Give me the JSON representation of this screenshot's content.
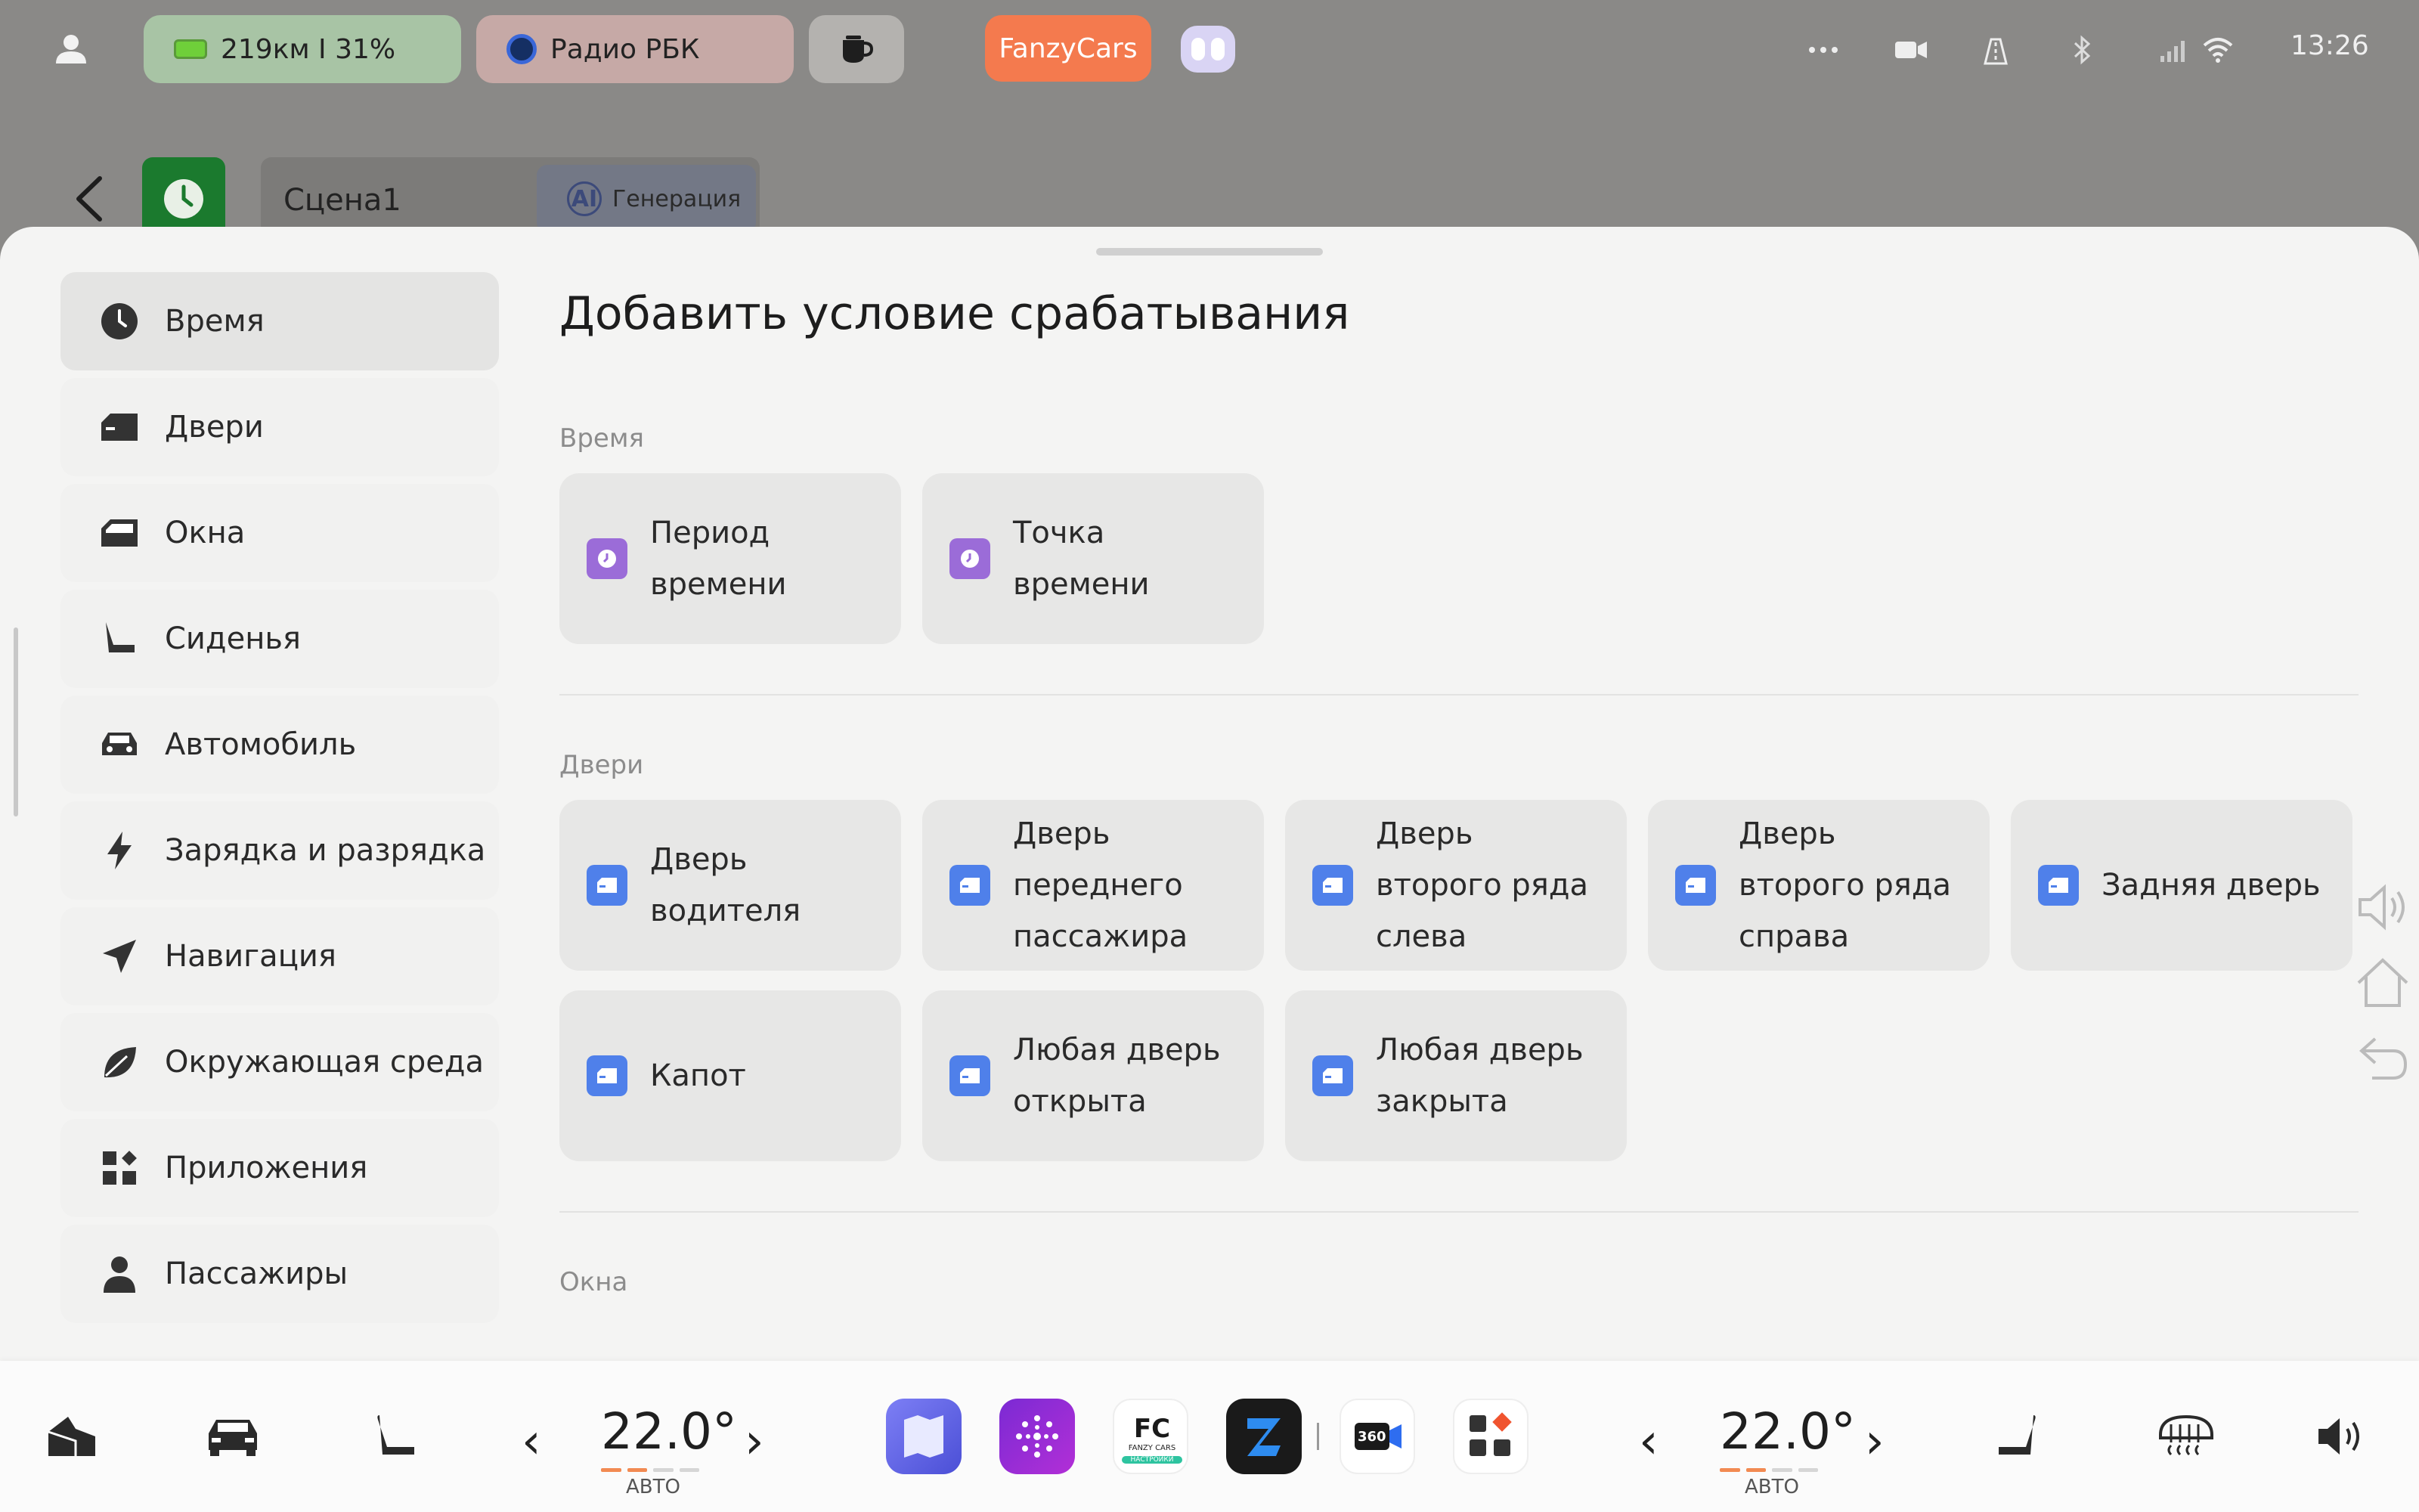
{
  "status_bar": {
    "battery_text": "219км I 31%",
    "radio_text": "Радио РБК",
    "brand_button": "FanzyCars",
    "time": "13:26",
    "icons": [
      "user-icon",
      "battery-icon",
      "radio-icon",
      "coffee-icon",
      "assistant-robot-icon",
      "more-icon",
      "camera-icon",
      "road-icon",
      "bluetooth-icon",
      "signal-icon",
      "wifi-icon"
    ]
  },
  "header": {
    "scene_name": "Сцена1",
    "generate_label": "Генерация",
    "ai_badge": "AI"
  },
  "sheet": {
    "title": "Добавить условие срабатывания",
    "nav": [
      {
        "label": "Время",
        "icon": "clock-icon",
        "active": true
      },
      {
        "label": "Двери",
        "icon": "door-icon"
      },
      {
        "label": "Окна",
        "icon": "window-icon"
      },
      {
        "label": "Сиденья",
        "icon": "seat-icon"
      },
      {
        "label": "Автомобиль",
        "icon": "car-icon"
      },
      {
        "label": "Зарядка и разрядка",
        "icon": "lightning-icon"
      },
      {
        "label": "Навигация",
        "icon": "navigation-icon"
      },
      {
        "label": "Окружающая среда",
        "icon": "leaf-icon"
      },
      {
        "label": "Приложения",
        "icon": "apps-icon"
      },
      {
        "label": "Пассажиры",
        "icon": "person-icon"
      }
    ],
    "sections": {
      "time": {
        "title": "Время",
        "items": [
          "Период времени",
          "Точка времени"
        ]
      },
      "doors": {
        "title": "Двери",
        "items": [
          "Дверь водителя",
          "Дверь переднего пассажира",
          "Дверь второго ряда слева",
          "Дверь второго ряда справа",
          "Задняя дверь",
          "Капот",
          "Любая дверь открыта",
          "Любая дверь закрыта"
        ]
      },
      "windows": {
        "title": "Окна"
      }
    }
  },
  "dock": {
    "left_temp": "22.0°",
    "left_mode": "АВТО",
    "right_temp": "22.0°",
    "right_mode": "АВТО",
    "fc_label_top": "FC",
    "fc_label_mid": "FANZY CARS",
    "fc_label_bot": "НАСТРОЙКИ",
    "cam_label": "360"
  },
  "colors": {
    "accent_orange": "#f47a4e",
    "time_icon": "#9b6cd8",
    "door_icon": "#4f80ea"
  }
}
